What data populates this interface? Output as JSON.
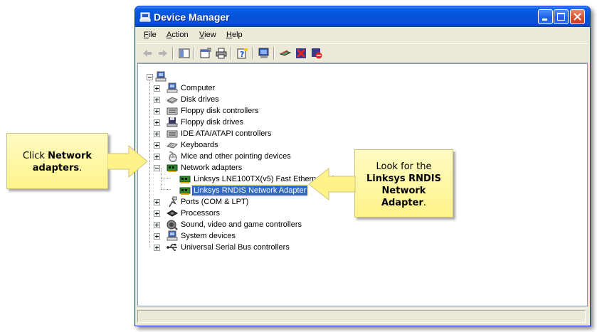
{
  "window": {
    "title": "Device Manager"
  },
  "menu": {
    "file": "File",
    "action": "Action",
    "view": "View",
    "help": "Help"
  },
  "tree": {
    "root_icon": "computer-icon",
    "items": [
      {
        "label": "Computer",
        "icon": "computer-icon",
        "expanded": false
      },
      {
        "label": "Disk drives",
        "icon": "disk-drive-icon",
        "expanded": false
      },
      {
        "label": "Floppy disk controllers",
        "icon": "controller-icon",
        "expanded": false
      },
      {
        "label": "Floppy disk drives",
        "icon": "floppy-icon",
        "expanded": false
      },
      {
        "label": "IDE ATA/ATAPI controllers",
        "icon": "controller-icon",
        "expanded": false
      },
      {
        "label": "Keyboards",
        "icon": "keyboard-icon",
        "expanded": false
      },
      {
        "label": "Mice and other pointing devices",
        "icon": "mouse-icon",
        "expanded": false
      },
      {
        "label": "Network adapters",
        "icon": "network-card-icon",
        "expanded": true,
        "children": [
          {
            "label": "Linksys LNE100TX(v5) Fast Ethernet Adapter",
            "icon": "network-card-icon",
            "selected": false
          },
          {
            "label": "Linksys RNDIS Network Adapter",
            "icon": "network-card-icon",
            "selected": true
          }
        ]
      },
      {
        "label": "Ports (COM & LPT)",
        "icon": "port-icon",
        "expanded": false
      },
      {
        "label": "Processors",
        "icon": "processor-icon",
        "expanded": false
      },
      {
        "label": "Sound, video and game controllers",
        "icon": "sound-icon",
        "expanded": false
      },
      {
        "label": "System devices",
        "icon": "computer-icon",
        "expanded": false
      },
      {
        "label": "Universal Serial Bus controllers",
        "icon": "usb-icon",
        "expanded": false
      }
    ]
  },
  "callouts": {
    "left": {
      "pre": "Click ",
      "bold1": "Network",
      "bold2": "adapters",
      "post": "."
    },
    "right": {
      "line1": "Look for the",
      "bold1": "Linksys RNDIS",
      "bold2": "Network",
      "bold3": "Adapter",
      "post": "."
    }
  },
  "colors": {
    "titlebar": "#0553db",
    "selection": "#316ac5",
    "callout": "#fff38a"
  }
}
